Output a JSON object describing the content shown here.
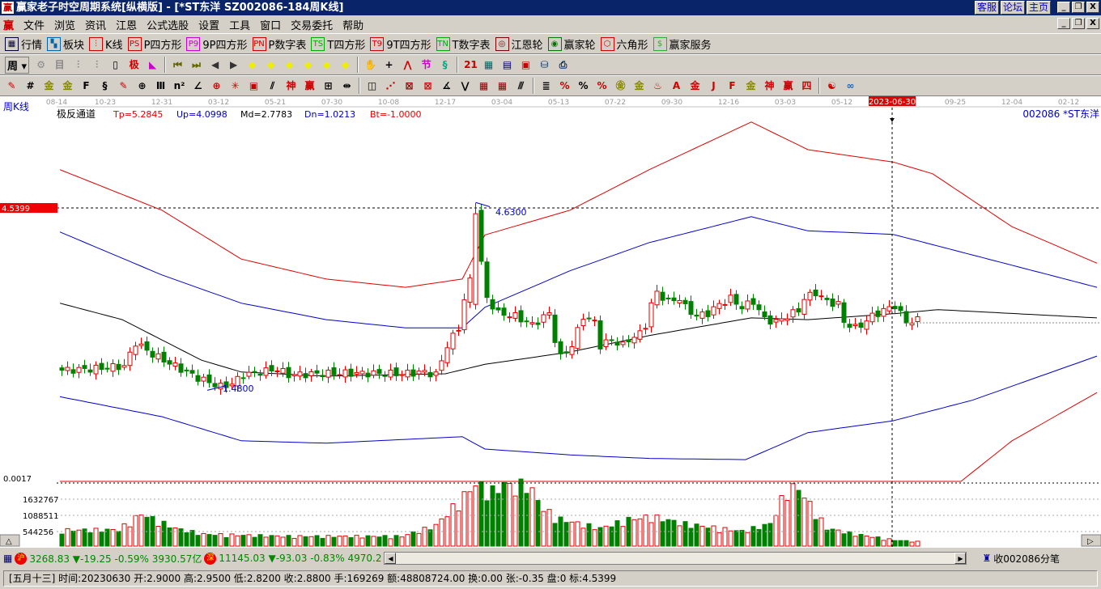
{
  "window": {
    "title": "赢家老子时空周期系统[纵横版] - [*ST东洋  SZ002086-184周K线]",
    "links": [
      "客服",
      "论坛",
      "主页"
    ],
    "controls": [
      "_",
      "❐",
      "X"
    ]
  },
  "menu": [
    "文件",
    "浏览",
    "资讯",
    "江恩",
    "公式选股",
    "设置",
    "工具",
    "窗口",
    "交易委托",
    "帮助"
  ],
  "toolbar1": [
    {
      "icon": "table-icon",
      "glyph": "▦",
      "color": "#003",
      "label": "行情"
    },
    {
      "icon": "blocks-icon",
      "glyph": "▚",
      "color": "#06a",
      "label": "板块"
    },
    {
      "icon": "kline-icon",
      "glyph": "⫶",
      "color": "#c00",
      "label": "K线"
    },
    {
      "icon": "ps-icon",
      "glyph": "PS",
      "color": "#c00",
      "label": "P四方形"
    },
    {
      "icon": "p9-icon",
      "glyph": "P9",
      "color": "#c0c",
      "label": "9P四方形"
    },
    {
      "icon": "pn-icon",
      "glyph": "PN",
      "color": "#c00",
      "label": "P数字表"
    },
    {
      "icon": "ts-icon",
      "glyph": "TS",
      "color": "#0a0",
      "label": "T四方形"
    },
    {
      "icon": "t9-icon",
      "glyph": "T9",
      "color": "#c00",
      "label": "9T四方形"
    },
    {
      "icon": "tn-icon",
      "glyph": "TN",
      "color": "#0a0",
      "label": "T数字表"
    },
    {
      "icon": "gann-wheel-icon",
      "glyph": "◎",
      "color": "#700",
      "label": "江恩轮"
    },
    {
      "icon": "winner-wheel-icon",
      "glyph": "◉",
      "color": "#070",
      "label": "赢家轮"
    },
    {
      "icon": "hexagon-icon",
      "glyph": "⬡",
      "color": "#c00",
      "label": "六角形"
    },
    {
      "icon": "dollar-icon",
      "glyph": "$",
      "color": "#3a3",
      "label": "赢家服务"
    }
  ],
  "period": "周",
  "toolbar2_icons": [
    [
      "layers-icon",
      "⚙",
      "#888"
    ],
    [
      "doc-icon",
      "目",
      "#888"
    ],
    [
      "bars3-icon",
      "⫶",
      "#888"
    ],
    [
      "bars9-icon",
      "⫶",
      "#888"
    ],
    [
      "candle-icon",
      "▯",
      "#000"
    ],
    [
      "extreme-icon",
      "极",
      "#c00"
    ],
    [
      "flag-icon",
      "◣",
      "#c0c"
    ],
    [
      "first-icon",
      "⏮",
      "#660"
    ],
    [
      "last-icon",
      "⏭",
      "#660"
    ],
    [
      "left-icon",
      "◀",
      "#333"
    ],
    [
      "right-icon",
      "▶",
      "#333"
    ],
    [
      "diamond-left-icon",
      "◆",
      "#ee0"
    ],
    [
      "diamond-right-icon",
      "◆",
      "#ee0"
    ],
    [
      "diamond-lr-icon",
      "◆",
      "#ee0"
    ],
    [
      "diamond-x-icon",
      "◆",
      "#ee0"
    ],
    [
      "diamond-star-icon",
      "◆",
      "#ee0"
    ],
    [
      "diamond-ud-icon",
      "◆",
      "#ee0"
    ],
    [
      "hand-icon",
      "✋",
      "#000"
    ],
    [
      "crosshair-icon",
      "+",
      "#000"
    ],
    [
      "line-tool-icon",
      "⋀",
      "#c00"
    ],
    [
      "pattern-icon",
      "节",
      "#c0c"
    ],
    [
      "cycle-icon",
      "§",
      "#0a8"
    ],
    [
      "calendar-icon",
      "21",
      "#c00"
    ],
    [
      "calculator-icon",
      "▦",
      "#066"
    ],
    [
      "notes-icon",
      "▤",
      "#006"
    ],
    [
      "save-icon",
      "▣",
      "#c00"
    ],
    [
      "network-icon",
      "⛁",
      "#036"
    ],
    [
      "printer-icon",
      "⎙",
      "#036"
    ]
  ],
  "toolbar3_icons": [
    [
      "pen-icon",
      "✎",
      "#c00"
    ],
    [
      "grid-icon",
      "#",
      "#000"
    ],
    [
      "gold-icon",
      "金",
      "#880"
    ],
    [
      "gold2-icon",
      "金",
      "#880"
    ],
    [
      "fib-icon",
      "F",
      "#000"
    ],
    [
      "spiral-icon",
      "§",
      "#000"
    ],
    [
      "brush-icon",
      "✎",
      "#c00"
    ],
    [
      "circle-icon",
      "⊕",
      "#000"
    ],
    [
      "lines-icon",
      "Ⅲ",
      "#000"
    ],
    [
      "n2-icon",
      "n²",
      "#000"
    ],
    [
      "angle-icon",
      "∠",
      "#000"
    ],
    [
      "target-icon",
      "⊕",
      "#c00"
    ],
    [
      "star-icon",
      "✳",
      "#c00"
    ],
    [
      "box-icon",
      "▣",
      "#c00"
    ],
    [
      "slash-icon",
      "⫽",
      "#000"
    ],
    [
      "god-icon",
      "神",
      "#c00"
    ],
    [
      "win-icon",
      "赢",
      "#c00"
    ],
    [
      "ruler-icon",
      "⊞",
      "#000"
    ],
    [
      "measure-icon",
      "⇹",
      "#000"
    ],
    [
      "rect-icon",
      "◫",
      "#000"
    ],
    [
      "fan-icon",
      "⋰",
      "#c00"
    ],
    [
      "box2-icon",
      "⊠",
      "#800"
    ],
    [
      "box3-icon",
      "⊠",
      "#c00"
    ],
    [
      "angle2-icon",
      "∡",
      "#000"
    ],
    [
      "wave-icon",
      "⋁",
      "#000"
    ],
    [
      "mesh-icon",
      "▦",
      "#800"
    ],
    [
      "mesh2-icon",
      "▦",
      "#800"
    ],
    [
      "parallel-icon",
      "⫻",
      "#000"
    ],
    [
      "table2-icon",
      "≣",
      "#000"
    ],
    [
      "pct-icon",
      "%",
      "#c00"
    ],
    [
      "pct2-icon",
      "%",
      "#000"
    ],
    [
      "pct3-icon",
      "%",
      "#c00"
    ],
    [
      "gold-circle-icon",
      "㊎",
      "#880"
    ],
    [
      "gold-line-icon",
      "金",
      "#880"
    ],
    [
      "fire-icon",
      "♨",
      "#c00"
    ],
    [
      "ab-icon",
      "A",
      "#c00"
    ],
    [
      "gold-line2-icon",
      "金",
      "#c00"
    ],
    [
      "j-angle-icon",
      "J",
      "#c00"
    ],
    [
      "f-angle-icon",
      "F",
      "#c00"
    ],
    [
      "gold-angle-icon",
      "金",
      "#880"
    ],
    [
      "god-angle-icon",
      "神",
      "#c00"
    ],
    [
      "win-angle-icon",
      "赢",
      "#c00"
    ],
    [
      "four-angle-icon",
      "四",
      "#c00"
    ],
    [
      "taiji-icon",
      "☯",
      "#c00"
    ],
    [
      "infinity-icon",
      "∞",
      "#06c"
    ]
  ],
  "chart": {
    "period_label": "周K线",
    "indicator_name": "极反通道",
    "params": [
      {
        "text": "Tp=5.2845",
        "color": "#e00000"
      },
      {
        "text": "Up=4.0998",
        "color": "#0000cc"
      },
      {
        "text": "Md=2.7783",
        "color": "#000000"
      },
      {
        "text": "Dn=1.0213",
        "color": "#0000cc"
      },
      {
        "text": "Bt=-1.0000",
        "color": "#e00000"
      }
    ],
    "stock_label": "002086 *ST东洋",
    "date_ticks": [
      "08-14",
      "10-23",
      "12-31",
      "03-12",
      "05-21",
      "07-30",
      "10-08",
      "12-17",
      "03-04",
      "05-13",
      "07-22",
      "09-30",
      "12-16",
      "03-03",
      "05-12",
      "2023-06-30",
      "09-25",
      "12-04",
      "02-12"
    ],
    "cursor_date": "2023-06-30",
    "price_marker": "4.5399",
    "high_label": "4.6300",
    "low_label": "1.4800",
    "bottom_price_label": "0.0017",
    "volume_ticks": [
      "1632767",
      "1088511",
      "544256"
    ]
  },
  "chart_data": {
    "type": "candlestick",
    "price_range": [
      -0.15,
      6.4
    ],
    "weeks": 152,
    "close_keypoints": [
      [
        0,
        1.78
      ],
      [
        5,
        1.8
      ],
      [
        11,
        1.85
      ],
      [
        13,
        2.25
      ],
      [
        16,
        2.05
      ],
      [
        20,
        1.85
      ],
      [
        24,
        1.65
      ],
      [
        28,
        1.5
      ],
      [
        30,
        1.55
      ],
      [
        32,
        1.7
      ],
      [
        35,
        1.75
      ],
      [
        38,
        1.8
      ],
      [
        40,
        1.7
      ],
      [
        45,
        1.72
      ],
      [
        50,
        1.73
      ],
      [
        60,
        1.72
      ],
      [
        64,
        1.75
      ],
      [
        66,
        1.7
      ],
      [
        68,
        2.2
      ],
      [
        70,
        2.5
      ],
      [
        71,
        2.98
      ],
      [
        72,
        3.3
      ],
      [
        73,
        4.5
      ],
      [
        74,
        3.6
      ],
      [
        75,
        3.0
      ],
      [
        77,
        2.75
      ],
      [
        80,
        2.7
      ],
      [
        83,
        2.55
      ],
      [
        86,
        2.75
      ],
      [
        87,
        2.3
      ],
      [
        88,
        2.0
      ],
      [
        90,
        2.2
      ],
      [
        92,
        2.7
      ],
      [
        94,
        2.6
      ],
      [
        95,
        2.2
      ],
      [
        97,
        2.3
      ],
      [
        99,
        2.2
      ],
      [
        100,
        2.3
      ],
      [
        102,
        2.4
      ],
      [
        103,
        2.55
      ],
      [
        104,
        2.9
      ],
      [
        105,
        3.1
      ],
      [
        107,
        2.95
      ],
      [
        109,
        3.0
      ],
      [
        110,
        2.85
      ],
      [
        112,
        2.7
      ],
      [
        114,
        2.75
      ],
      [
        116,
        2.9
      ],
      [
        118,
        3.0
      ],
      [
        120,
        2.85
      ],
      [
        122,
        2.95
      ],
      [
        124,
        2.65
      ],
      [
        126,
        2.6
      ],
      [
        128,
        2.7
      ],
      [
        130,
        2.8
      ],
      [
        131,
        3.0
      ],
      [
        133,
        3.1
      ],
      [
        135,
        2.95
      ],
      [
        137,
        2.9
      ],
      [
        138,
        2.6
      ],
      [
        140,
        2.5
      ],
      [
        141,
        2.55
      ],
      [
        143,
        2.7
      ],
      [
        145,
        2.8
      ],
      [
        147,
        2.88
      ],
      [
        149,
        2.6
      ],
      [
        151,
        2.63
      ]
    ],
    "volume_keypoints": [
      [
        0,
        0.54
      ],
      [
        10,
        0.55
      ],
      [
        14,
        1.09
      ],
      [
        20,
        0.6
      ],
      [
        25,
        0.4
      ],
      [
        40,
        0.33
      ],
      [
        60,
        0.33
      ],
      [
        66,
        0.7
      ],
      [
        70,
        1.5
      ],
      [
        73,
        2.1
      ],
      [
        76,
        1.85
      ],
      [
        78,
        2.1
      ],
      [
        80,
        1.95
      ],
      [
        82,
        2.15
      ],
      [
        85,
        1.25
      ],
      [
        88,
        0.9
      ],
      [
        95,
        0.6
      ],
      [
        100,
        0.9
      ],
      [
        104,
        1.0
      ],
      [
        110,
        0.75
      ],
      [
        120,
        0.5
      ],
      [
        125,
        0.75
      ],
      [
        128,
        1.95
      ],
      [
        130,
        1.95
      ],
      [
        132,
        1.4
      ],
      [
        135,
        0.6
      ],
      [
        140,
        0.4
      ],
      [
        147,
        0.2
      ],
      [
        151,
        0.15
      ]
    ],
    "volume_unit": "millions",
    "channels": [
      {
        "name": "Tp",
        "color": "#e00000",
        "points": [
          [
            0,
            5.19
          ],
          [
            18,
            4.5
          ],
          [
            32,
            3.67
          ],
          [
            47,
            3.33
          ],
          [
            61,
            3.19
          ],
          [
            71,
            3.33
          ],
          [
            75,
            4.08
          ],
          [
            90,
            4.5
          ],
          [
            104,
            5.19
          ],
          [
            122,
            6.0
          ],
          [
            132,
            5.53
          ],
          [
            147,
            5.32
          ],
          [
            154,
            5.12
          ],
          [
            168,
            4.22
          ],
          [
            183,
            3.6
          ]
        ]
      },
      {
        "name": "Up",
        "color": "#0000cc",
        "points": [
          [
            0,
            4.13
          ],
          [
            18,
            3.4
          ],
          [
            32,
            2.92
          ],
          [
            47,
            2.64
          ],
          [
            61,
            2.5
          ],
          [
            71,
            2.5
          ],
          [
            75,
            2.85
          ],
          [
            90,
            3.47
          ],
          [
            104,
            3.95
          ],
          [
            122,
            4.39
          ],
          [
            132,
            4.15
          ],
          [
            147,
            4.09
          ],
          [
            161,
            3.74
          ],
          [
            183,
            3.19
          ]
        ]
      },
      {
        "name": "Md",
        "color": "#000000",
        "points": [
          [
            0,
            2.92
          ],
          [
            11,
            2.64
          ],
          [
            25,
            1.95
          ],
          [
            32,
            1.75
          ],
          [
            47,
            1.68
          ],
          [
            68,
            1.72
          ],
          [
            75,
            1.88
          ],
          [
            90,
            2.09
          ],
          [
            104,
            2.37
          ],
          [
            122,
            2.67
          ],
          [
            132,
            2.64
          ],
          [
            147,
            2.74
          ],
          [
            155,
            2.81
          ],
          [
            183,
            2.67
          ]
        ]
      },
      {
        "name": "Dn",
        "color": "#0000cc",
        "points": [
          [
            0,
            1.33
          ],
          [
            18,
            0.99
          ],
          [
            32,
            0.58
          ],
          [
            47,
            0.54
          ],
          [
            71,
            0.65
          ],
          [
            75,
            0.44
          ],
          [
            90,
            0.34
          ],
          [
            104,
            0.28
          ],
          [
            121,
            0.26
          ],
          [
            132,
            0.72
          ],
          [
            147,
            0.92
          ],
          [
            161,
            1.27
          ],
          [
            183,
            2.02
          ]
        ]
      },
      {
        "name": "Bt",
        "color": "#e00000",
        "points": [
          [
            0,
            -0.11
          ],
          [
            159,
            -0.11
          ],
          [
            168,
            0.58
          ],
          [
            183,
            1.4
          ]
        ]
      }
    ]
  },
  "status": {
    "index1_badge": "沪",
    "index1": "3268.83 ▼-19.25 -0.59% 3930.57亿",
    "index2_badge": "深",
    "index2": "11145.03 ▼-93.03 -0.83% 4970.2",
    "tick_label": "收002086分笔",
    "detail": "[五月十三] 时间:20230630 开:2.9000 高:2.9500 低:2.8200 收:2.8800 手:169269 额:48808724.00 换:0.00 张:-0.35 盘:0 标:4.5399"
  }
}
